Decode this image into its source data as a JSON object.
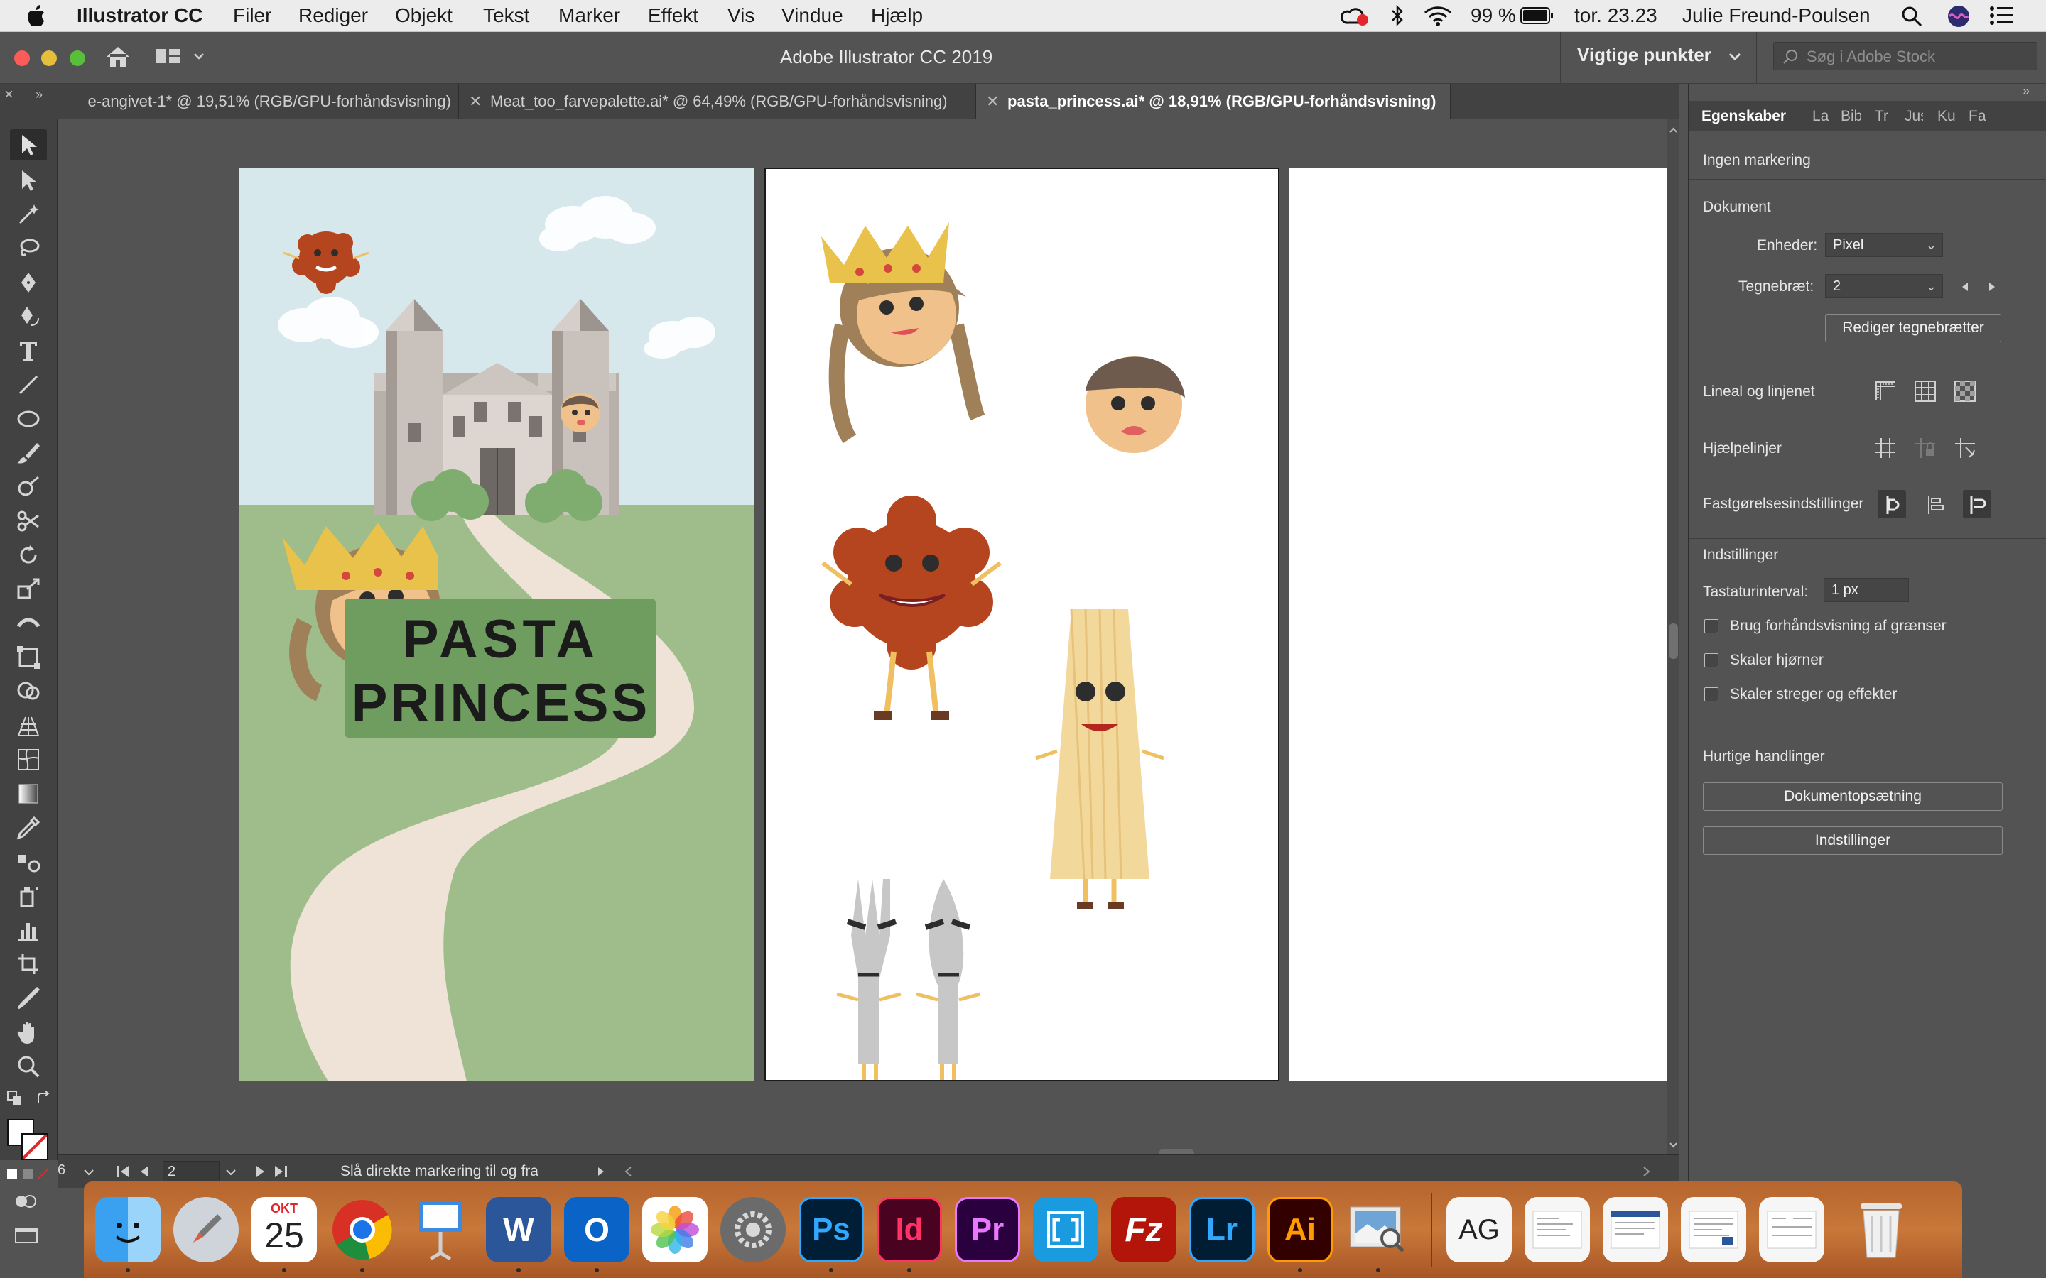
{
  "menubar": {
    "app_name": "Illustrator CC",
    "menus": [
      "Filer",
      "Rediger",
      "Objekt",
      "Tekst",
      "Marker",
      "Effekt",
      "Vis",
      "Vindue",
      "Hjælp"
    ],
    "battery": "99 %",
    "clock": "tor. 23.23",
    "user": "Julie Freund-Poulsen"
  },
  "appbar": {
    "title": "Adobe Illustrator CC 2019",
    "workspace": "Vigtige punkter",
    "search_placeholder": "Søg i Adobe Stock"
  },
  "tabs": [
    {
      "label": "e-angivet-1* @ 19,51% (RGB/GPU-forhåndsvisning)",
      "active": false
    },
    {
      "label": "Meat_too_farvepalette.ai* @ 64,49% (RGB/GPU-forhåndsvisning)",
      "active": false
    },
    {
      "label": "pasta_princess.ai* @ 18,91% (RGB/GPU-forhåndsvisning)",
      "active": true
    }
  ],
  "artwork": {
    "poster_line1": "PASTA",
    "poster_line2": "PRINCESS"
  },
  "status": {
    "artboard_number": "2",
    "zoom_text": "6",
    "message": "Slå direkte markering til og fra"
  },
  "panel": {
    "tabs": [
      "Egenskaber",
      "La",
      "Bib",
      "Tr",
      "Jus",
      "Ku",
      "Fa"
    ],
    "no_selection": "Ingen markering",
    "document_heading": "Dokument",
    "units_label": "Enheder:",
    "units_value": "Pixel",
    "artboard_label": "Tegnebræt:",
    "artboard_value": "2",
    "edit_artboards_button": "Rediger tegnebrætter",
    "rulers_label": "Lineal og linjenet",
    "guides_label": "Hjælpelinjer",
    "snap_label": "Fastgørelsesindstillinger",
    "preferences_heading": "Indstillinger",
    "keyboard_increment_label": "Tastaturinterval:",
    "keyboard_increment_value": "1 px",
    "checkboxes": [
      "Brug forhåndsvisning af grænser",
      "Skaler hjørner",
      "Skaler streger og effekter"
    ],
    "quick_actions_heading": "Hurtige handlinger",
    "document_setup_button": "Dokumentopsætning",
    "preferences_button": "Indstillinger"
  },
  "dock": {
    "calendar_month": "OKT",
    "calendar_day": "25",
    "apps": [
      "Finder",
      "Launchpad",
      "Kalender",
      "Chrome",
      "Keynote",
      "Word",
      "Outlook",
      "Fotos",
      "Systemindstillinger",
      "Photoshop",
      "InDesign",
      "Premiere Pro",
      "Brackets",
      "FileZilla",
      "Lightroom",
      "Illustrator",
      "Preview"
    ],
    "labels": {
      "ps": "Ps",
      "id": "Id",
      "pr": "Pr",
      "lr": "Lr",
      "ai": "Ai",
      "fz": "Fz",
      "word": "W",
      "outlook": "O",
      "ag": "AG"
    }
  }
}
